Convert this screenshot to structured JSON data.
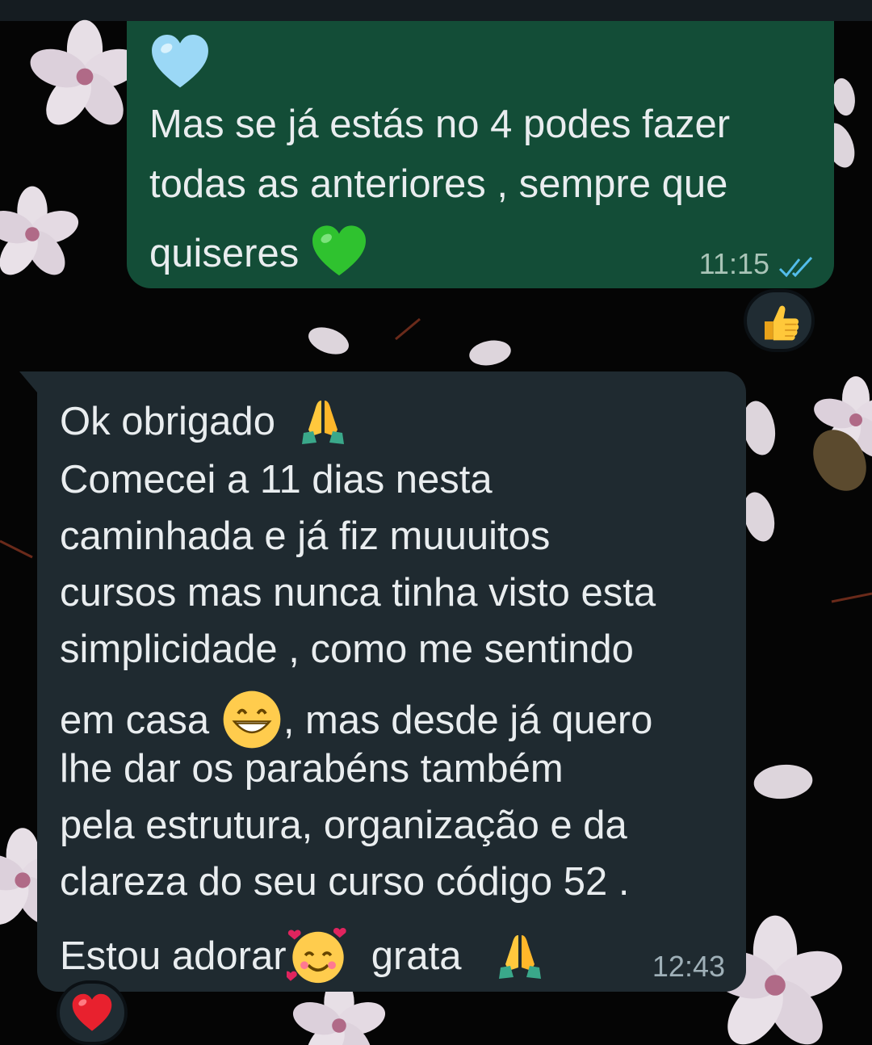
{
  "outgoing_message": {
    "top_emoji": "light-blue-heart",
    "lines": [
      "Mas se já estás no 4 podes fazer",
      "todas as anteriores , sempre que",
      "quiseres"
    ],
    "trailing_emoji": "green-heart",
    "time": "11:15",
    "status": "read",
    "reaction": "thumbs-up"
  },
  "incoming_message": {
    "lines": [
      "Ok obrigado",
      "Comecei a 11 dias nesta",
      "caminhada e já fiz muuuitos",
      "cursos mas nunca tinha visto esta",
      "simplicidade , como me sentindo",
      "em casa",
      ", mas desde já quero",
      "lhe dar os parabéns também",
      "pela estrutura, organização e da",
      "clareza do seu curso código 52 .",
      "Estou adorar",
      "grata"
    ],
    "emojis": [
      "folded-hands",
      "grinning-face",
      "smiling-face-with-hearts",
      "folded-hands"
    ],
    "time": "12:43",
    "reaction": "red-heart"
  },
  "colors": {
    "outgoing_bubble": "#134d37",
    "incoming_bubble": "#1f2a30",
    "read_ticks": "#53bdeb",
    "text": "#e9edef"
  }
}
